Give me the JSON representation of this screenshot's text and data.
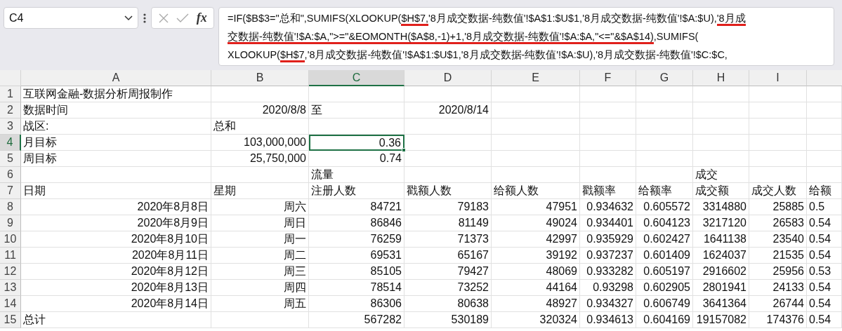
{
  "name_box": {
    "value": "C4"
  },
  "formula_bar": {
    "fx": "fx",
    "lines": [
      [
        {
          "text": "=IF($B$3=\"总和\",SUMIFS(XLOOKUP(",
          "underlined": false
        },
        {
          "text": "$H$7,",
          "underlined": true
        },
        {
          "text": "'8月成交数据-纯数值'!$A$1:$U$1,'8月成交数据-纯数值'!$A:$U),",
          "underlined": false
        },
        {
          "text": "'8月成",
          "underlined": true
        }
      ],
      [
        {
          "text": "交数据-纯数值'!$A:$A,\">=\"&EOMONTH($A$8,-1)+1,'8月成交数据-纯数值'!$A:$A,\"<=\"&$A$14)",
          "underlined": true
        },
        {
          "text": ",SUMIFS(",
          "underlined": false
        }
      ],
      [
        {
          "text": "XLOOKUP(",
          "underlined": false
        },
        {
          "text": "$H$7",
          "underlined": true
        },
        {
          "text": ",'8月成交数据-纯数值'!$A$1:$U$1,'8月成交数据-纯数值'!$A:$U),'8月成交数据-纯数值'!$C:$C,",
          "underlined": false
        }
      ]
    ]
  },
  "columns": [
    {
      "letter": "A",
      "selected": false
    },
    {
      "letter": "B",
      "selected": false
    },
    {
      "letter": "C",
      "selected": true
    },
    {
      "letter": "D",
      "selected": false
    },
    {
      "letter": "E",
      "selected": false
    },
    {
      "letter": "F",
      "selected": false
    },
    {
      "letter": "G",
      "selected": false
    },
    {
      "letter": "H",
      "selected": false
    },
    {
      "letter": "I",
      "selected": false
    }
  ],
  "rows": [
    {
      "number": "1",
      "selected": false,
      "cells": {
        "A": {
          "text": "互联网金融-数据分析周报制作",
          "kind": "text",
          "selected": false
        }
      }
    },
    {
      "number": "2",
      "selected": false,
      "cells": {
        "A": {
          "text": "数据时间",
          "kind": "text",
          "selected": false
        },
        "B": {
          "text": "2020/8/8",
          "kind": "number",
          "selected": false
        },
        "C": {
          "text": "至",
          "kind": "text",
          "selected": false
        },
        "D": {
          "text": "2020/8/14",
          "kind": "number",
          "selected": false
        }
      }
    },
    {
      "number": "3",
      "selected": false,
      "cells": {
        "A": {
          "text": "战区:",
          "kind": "text",
          "selected": false
        },
        "B": {
          "text": "总和",
          "kind": "text",
          "selected": false
        }
      }
    },
    {
      "number": "4",
      "selected": true,
      "cells": {
        "A": {
          "text": "月目标",
          "kind": "text",
          "selected": false
        },
        "B": {
          "text": "103,000,000",
          "kind": "number",
          "selected": false
        },
        "C": {
          "text": "0.36",
          "kind": "number",
          "selected": true
        }
      }
    },
    {
      "number": "5",
      "selected": false,
      "cells": {
        "A": {
          "text": "周目标",
          "kind": "text",
          "selected": false
        },
        "B": {
          "text": "25,750,000",
          "kind": "number",
          "selected": false
        },
        "C": {
          "text": "0.74",
          "kind": "number",
          "selected": false
        }
      }
    },
    {
      "number": "6",
      "selected": false,
      "cells": {
        "C": {
          "text": "流量",
          "kind": "text",
          "selected": false
        },
        "H": {
          "text": "成交",
          "kind": "text",
          "selected": false
        }
      }
    },
    {
      "number": "7",
      "selected": false,
      "cells": {
        "A": {
          "text": "日期",
          "kind": "text",
          "selected": false
        },
        "B": {
          "text": "星期",
          "kind": "text",
          "selected": false
        },
        "C": {
          "text": "注册人数",
          "kind": "text",
          "selected": false
        },
        "D": {
          "text": "戳额人数",
          "kind": "text",
          "selected": false
        },
        "E": {
          "text": "给额人数",
          "kind": "text",
          "selected": false
        },
        "F": {
          "text": "戳额率",
          "kind": "text",
          "selected": false
        },
        "G": {
          "text": "给额率",
          "kind": "text",
          "selected": false
        },
        "H": {
          "text": "成交额",
          "kind": "text",
          "selected": false
        },
        "I": {
          "text": "成交人数",
          "kind": "text",
          "selected": false
        },
        "J": {
          "text": "给额",
          "selected": false
        }
      }
    },
    {
      "number": "8",
      "selected": false,
      "cells": {
        "A": {
          "text": "2020年8月8日",
          "kind": "number",
          "selected": false
        },
        "B": {
          "text": "周六",
          "kind": "number",
          "selected": false
        },
        "C": {
          "text": "84721",
          "kind": "number",
          "selected": false
        },
        "D": {
          "text": "79183",
          "kind": "number",
          "selected": false
        },
        "E": {
          "text": "47951",
          "kind": "number",
          "selected": false
        },
        "F": {
          "text": "0.934632",
          "kind": "number",
          "selected": false
        },
        "G": {
          "text": "0.605572",
          "kind": "number",
          "selected": false
        },
        "H": {
          "text": "3314880",
          "kind": "number",
          "selected": false
        },
        "I": {
          "text": "25885",
          "kind": "number",
          "selected": false
        },
        "J": {
          "text": "0.5",
          "selected": false
        }
      }
    },
    {
      "number": "9",
      "selected": false,
      "cells": {
        "A": {
          "text": "2020年8月9日",
          "kind": "number",
          "selected": false
        },
        "B": {
          "text": "周日",
          "kind": "number",
          "selected": false
        },
        "C": {
          "text": "86846",
          "kind": "number",
          "selected": false
        },
        "D": {
          "text": "81149",
          "kind": "number",
          "selected": false
        },
        "E": {
          "text": "49024",
          "kind": "number",
          "selected": false
        },
        "F": {
          "text": "0.934401",
          "kind": "number",
          "selected": false
        },
        "G": {
          "text": "0.604123",
          "kind": "number",
          "selected": false
        },
        "H": {
          "text": "3217120",
          "kind": "number",
          "selected": false
        },
        "I": {
          "text": "26583",
          "kind": "number",
          "selected": false
        },
        "J": {
          "text": "0.54",
          "selected": false
        }
      }
    },
    {
      "number": "10",
      "selected": false,
      "cells": {
        "A": {
          "text": "2020年8月10日",
          "kind": "number",
          "selected": false
        },
        "B": {
          "text": "周一",
          "kind": "number",
          "selected": false
        },
        "C": {
          "text": "76259",
          "kind": "number",
          "selected": false
        },
        "D": {
          "text": "71373",
          "kind": "number",
          "selected": false
        },
        "E": {
          "text": "42997",
          "kind": "number",
          "selected": false
        },
        "F": {
          "text": "0.935929",
          "kind": "number",
          "selected": false
        },
        "G": {
          "text": "0.602427",
          "kind": "number",
          "selected": false
        },
        "H": {
          "text": "1641138",
          "kind": "number",
          "selected": false
        },
        "I": {
          "text": "23540",
          "kind": "number",
          "selected": false
        },
        "J": {
          "text": "0.54",
          "selected": false
        }
      }
    },
    {
      "number": "11",
      "selected": false,
      "cells": {
        "A": {
          "text": "2020年8月11日",
          "kind": "number",
          "selected": false
        },
        "B": {
          "text": "周二",
          "kind": "number",
          "selected": false
        },
        "C": {
          "text": "69531",
          "kind": "number",
          "selected": false
        },
        "D": {
          "text": "65167",
          "kind": "number",
          "selected": false
        },
        "E": {
          "text": "39192",
          "kind": "number",
          "selected": false
        },
        "F": {
          "text": "0.937237",
          "kind": "number",
          "selected": false
        },
        "G": {
          "text": "0.601409",
          "kind": "number",
          "selected": false
        },
        "H": {
          "text": "1624037",
          "kind": "number",
          "selected": false
        },
        "I": {
          "text": "21535",
          "kind": "number",
          "selected": false
        },
        "J": {
          "text": "0.54",
          "selected": false
        }
      }
    },
    {
      "number": "12",
      "selected": false,
      "cells": {
        "A": {
          "text": "2020年8月12日",
          "kind": "number",
          "selected": false
        },
        "B": {
          "text": "周三",
          "kind": "number",
          "selected": false
        },
        "C": {
          "text": "85105",
          "kind": "number",
          "selected": false
        },
        "D": {
          "text": "79427",
          "kind": "number",
          "selected": false
        },
        "E": {
          "text": "48069",
          "kind": "number",
          "selected": false
        },
        "F": {
          "text": "0.933282",
          "kind": "number",
          "selected": false
        },
        "G": {
          "text": "0.605197",
          "kind": "number",
          "selected": false
        },
        "H": {
          "text": "2916602",
          "kind": "number",
          "selected": false
        },
        "I": {
          "text": "25956",
          "kind": "number",
          "selected": false
        },
        "J": {
          "text": "0.53",
          "selected": false
        }
      }
    },
    {
      "number": "13",
      "selected": false,
      "cells": {
        "A": {
          "text": "2020年8月13日",
          "kind": "number",
          "selected": false
        },
        "B": {
          "text": "周四",
          "kind": "number",
          "selected": false
        },
        "C": {
          "text": "78514",
          "kind": "number",
          "selected": false
        },
        "D": {
          "text": "73252",
          "kind": "number",
          "selected": false
        },
        "E": {
          "text": "44164",
          "kind": "number",
          "selected": false
        },
        "F": {
          "text": "0.93298",
          "kind": "number",
          "selected": false
        },
        "G": {
          "text": "0.602905",
          "kind": "number",
          "selected": false
        },
        "H": {
          "text": "2801941",
          "kind": "number",
          "selected": false
        },
        "I": {
          "text": "24133",
          "kind": "number",
          "selected": false
        },
        "J": {
          "text": "0.54",
          "selected": false
        }
      }
    },
    {
      "number": "14",
      "selected": false,
      "cells": {
        "A": {
          "text": "2020年8月14日",
          "kind": "number",
          "selected": false
        },
        "B": {
          "text": "周五",
          "kind": "number",
          "selected": false
        },
        "C": {
          "text": "86306",
          "kind": "number",
          "selected": false
        },
        "D": {
          "text": "80638",
          "kind": "number",
          "selected": false
        },
        "E": {
          "text": "48927",
          "kind": "number",
          "selected": false
        },
        "F": {
          "text": "0.934327",
          "kind": "number",
          "selected": false
        },
        "G": {
          "text": "0.606749",
          "kind": "number",
          "selected": false
        },
        "H": {
          "text": "3641364",
          "kind": "number",
          "selected": false
        },
        "I": {
          "text": "26744",
          "kind": "number",
          "selected": false
        },
        "J": {
          "text": "0.54",
          "selected": false
        }
      }
    },
    {
      "number": "15",
      "selected": false,
      "cells": {
        "A": {
          "text": "总计",
          "kind": "text",
          "selected": false
        },
        "C": {
          "text": "567282",
          "kind": "number",
          "selected": false
        },
        "D": {
          "text": "530189",
          "kind": "number",
          "selected": false
        },
        "E": {
          "text": "320324",
          "kind": "number",
          "selected": false
        },
        "F": {
          "text": "0.934613",
          "kind": "number",
          "selected": false
        },
        "G": {
          "text": "0.604169",
          "kind": "number",
          "selected": false
        },
        "H": {
          "text": "19157082",
          "kind": "number",
          "selected": false
        },
        "I": {
          "text": "174376",
          "kind": "number",
          "selected": false
        },
        "J": {
          "text": "0.54",
          "selected": false
        }
      }
    }
  ]
}
